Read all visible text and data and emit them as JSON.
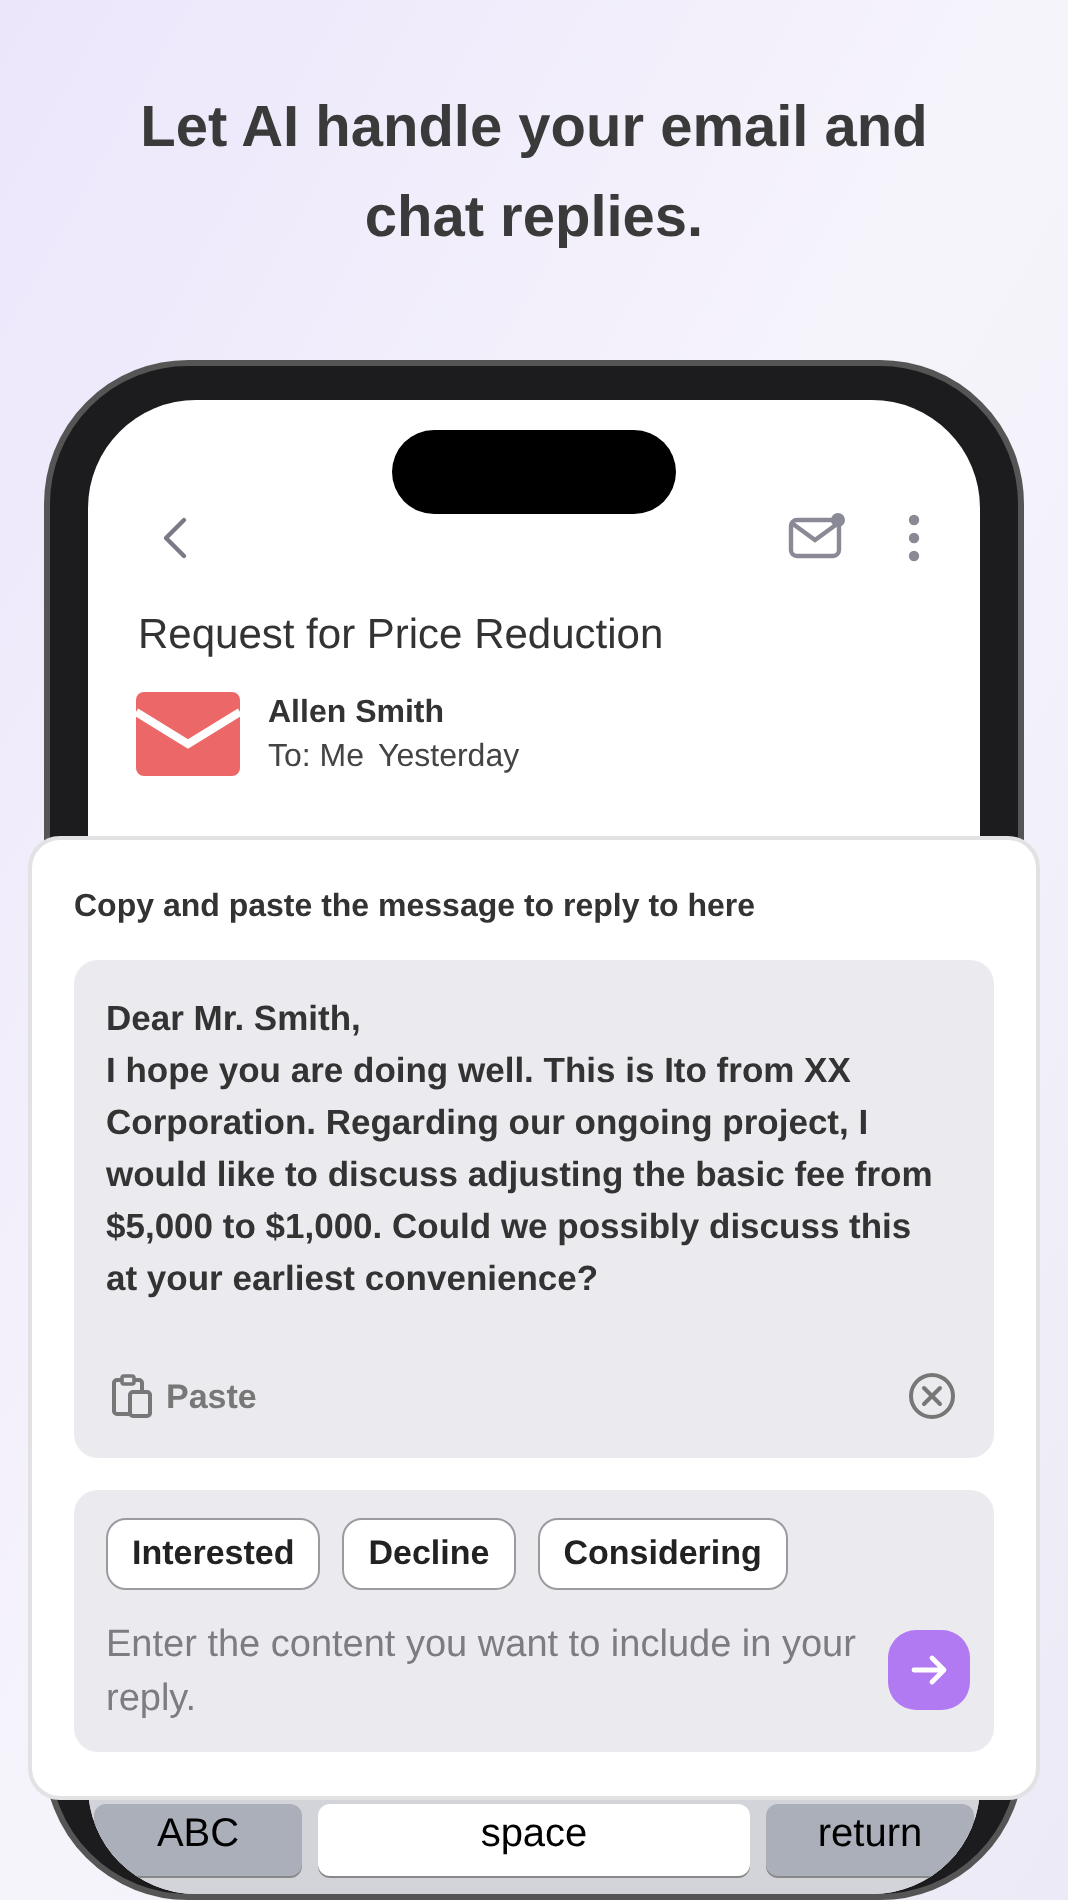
{
  "headline": "Let AI handle your email and chat replies.",
  "email": {
    "subject": "Request for Price Reduction",
    "sender": "Allen Smith",
    "recipient": "To: Me",
    "date": "Yesterday"
  },
  "reply_panel": {
    "heading": "Copy and paste the message to reply to here",
    "message": "Dear Mr. Smith,\nI hope you are doing well. This is Ito from XX Corporation. Regarding our ongoing project, I would like to discuss adjusting the basic fee from $5,000 to $1,000. Could we possibly discuss this at your earliest convenience?",
    "paste_label": "Paste",
    "chips": [
      {
        "label": "Interested"
      },
      {
        "label": "Decline"
      },
      {
        "label": "Considering"
      }
    ],
    "placeholder": "Enter the content you want to include in your reply."
  },
  "keyboard": [
    {
      "label": "ABC",
      "kind": "function"
    },
    {
      "label": "space",
      "kind": "space"
    },
    {
      "label": "return",
      "kind": "function"
    }
  ]
}
